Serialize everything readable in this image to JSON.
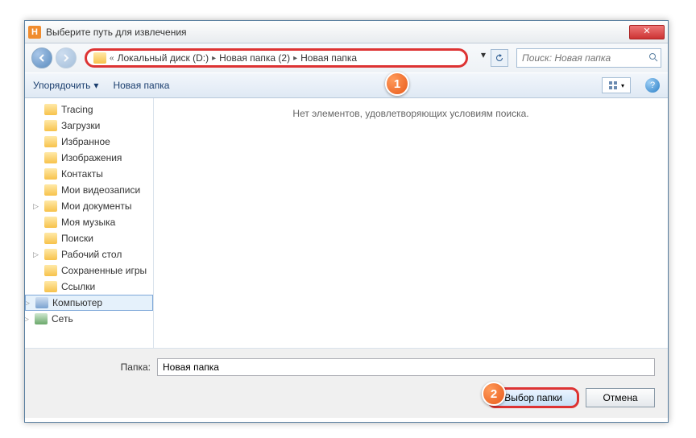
{
  "title": "Выберите путь для извлечения",
  "breadcrumb": {
    "prefix": "«",
    "parts": [
      "Локальный диск (D:)",
      "Новая папка (2)",
      "Новая папка"
    ]
  },
  "search": {
    "placeholder": "Поиск: Новая папка"
  },
  "toolbar": {
    "organize": "Упорядочить",
    "newfolder": "Новая папка"
  },
  "tree": {
    "items": [
      {
        "label": "Tracing",
        "exp": ""
      },
      {
        "label": "Загрузки",
        "exp": ""
      },
      {
        "label": "Избранное",
        "exp": ""
      },
      {
        "label": "Изображения",
        "exp": ""
      },
      {
        "label": "Контакты",
        "exp": ""
      },
      {
        "label": "Мои видеозаписи",
        "exp": ""
      },
      {
        "label": "Мои документы",
        "exp": "▷"
      },
      {
        "label": "Моя музыка",
        "exp": ""
      },
      {
        "label": "Поиски",
        "exp": ""
      },
      {
        "label": "Рабочий стол",
        "exp": "▷"
      },
      {
        "label": "Сохраненные игры",
        "exp": ""
      },
      {
        "label": "Ссылки",
        "exp": ""
      }
    ],
    "computer": "Компьютер",
    "network": "Сеть"
  },
  "content": {
    "empty": "Нет элементов, удовлетворяющих условиям поиска."
  },
  "footer": {
    "folder_label": "Папка:",
    "folder_value": "Новая папка",
    "select": "Выбор папки",
    "cancel": "Отмена"
  },
  "callouts": {
    "c1": "1",
    "c2": "2"
  }
}
